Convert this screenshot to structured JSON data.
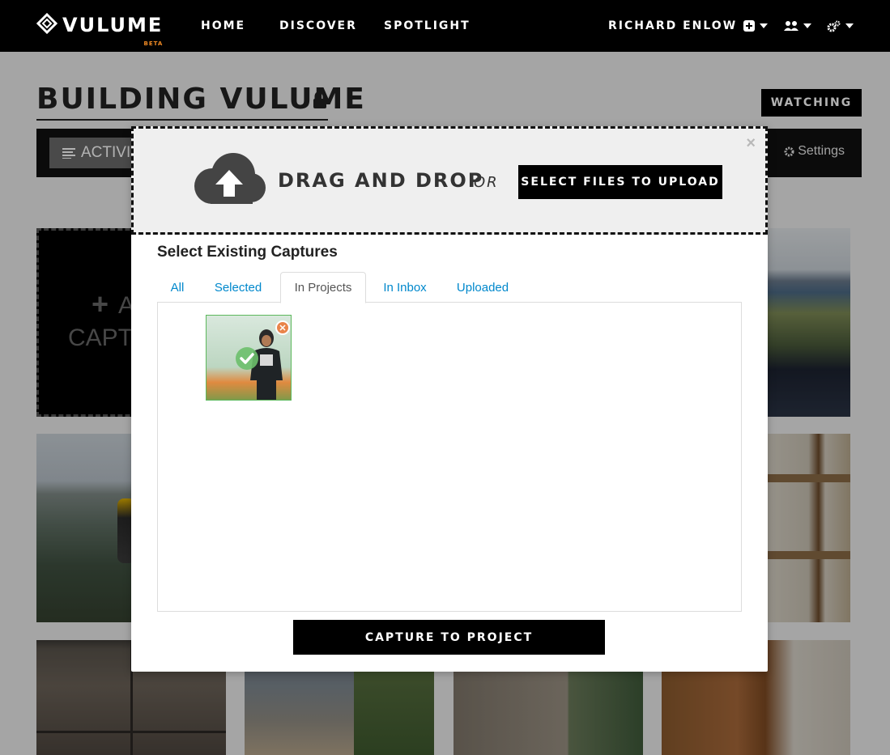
{
  "nav": {
    "logo_text": "VULUME",
    "logo_badge": "BETA",
    "links": [
      "HOME",
      "DISCOVER",
      "SPOTLIGHT"
    ],
    "user_name": "RICHARD ENLOW",
    "icons": [
      "plus-square-icon",
      "users-icon",
      "gears-icon"
    ]
  },
  "project": {
    "title": "BUILDING VULUME",
    "privacy_icon": "lock-icon",
    "watch_label": "WATCHING",
    "activity_tab_label": "ACTIVI",
    "settings_label": "Settings",
    "add_capture_line1": "A",
    "add_capture_line2": "CAPT"
  },
  "modal": {
    "close_symbol": "×",
    "drag_drop_label": "DRAG AND DROP",
    "or_label": "OR",
    "select_files_label": "SELECT FILES TO UPLOAD",
    "section_heading": "Select Existing Captures",
    "tabs": [
      "All",
      "Selected",
      "In Projects",
      "In Inbox",
      "Uploaded"
    ],
    "active_tab": "In Projects",
    "selected_count": 1,
    "remove_symbol": "✕",
    "submit_label": "CAPTURE TO PROJECT"
  },
  "colors": {
    "nav_bg": "#000000",
    "link_blue": "#0088cc",
    "badge_orange": "#f08a24",
    "selected_green": "#5cb85c",
    "remove_orange": "#e9844a"
  }
}
